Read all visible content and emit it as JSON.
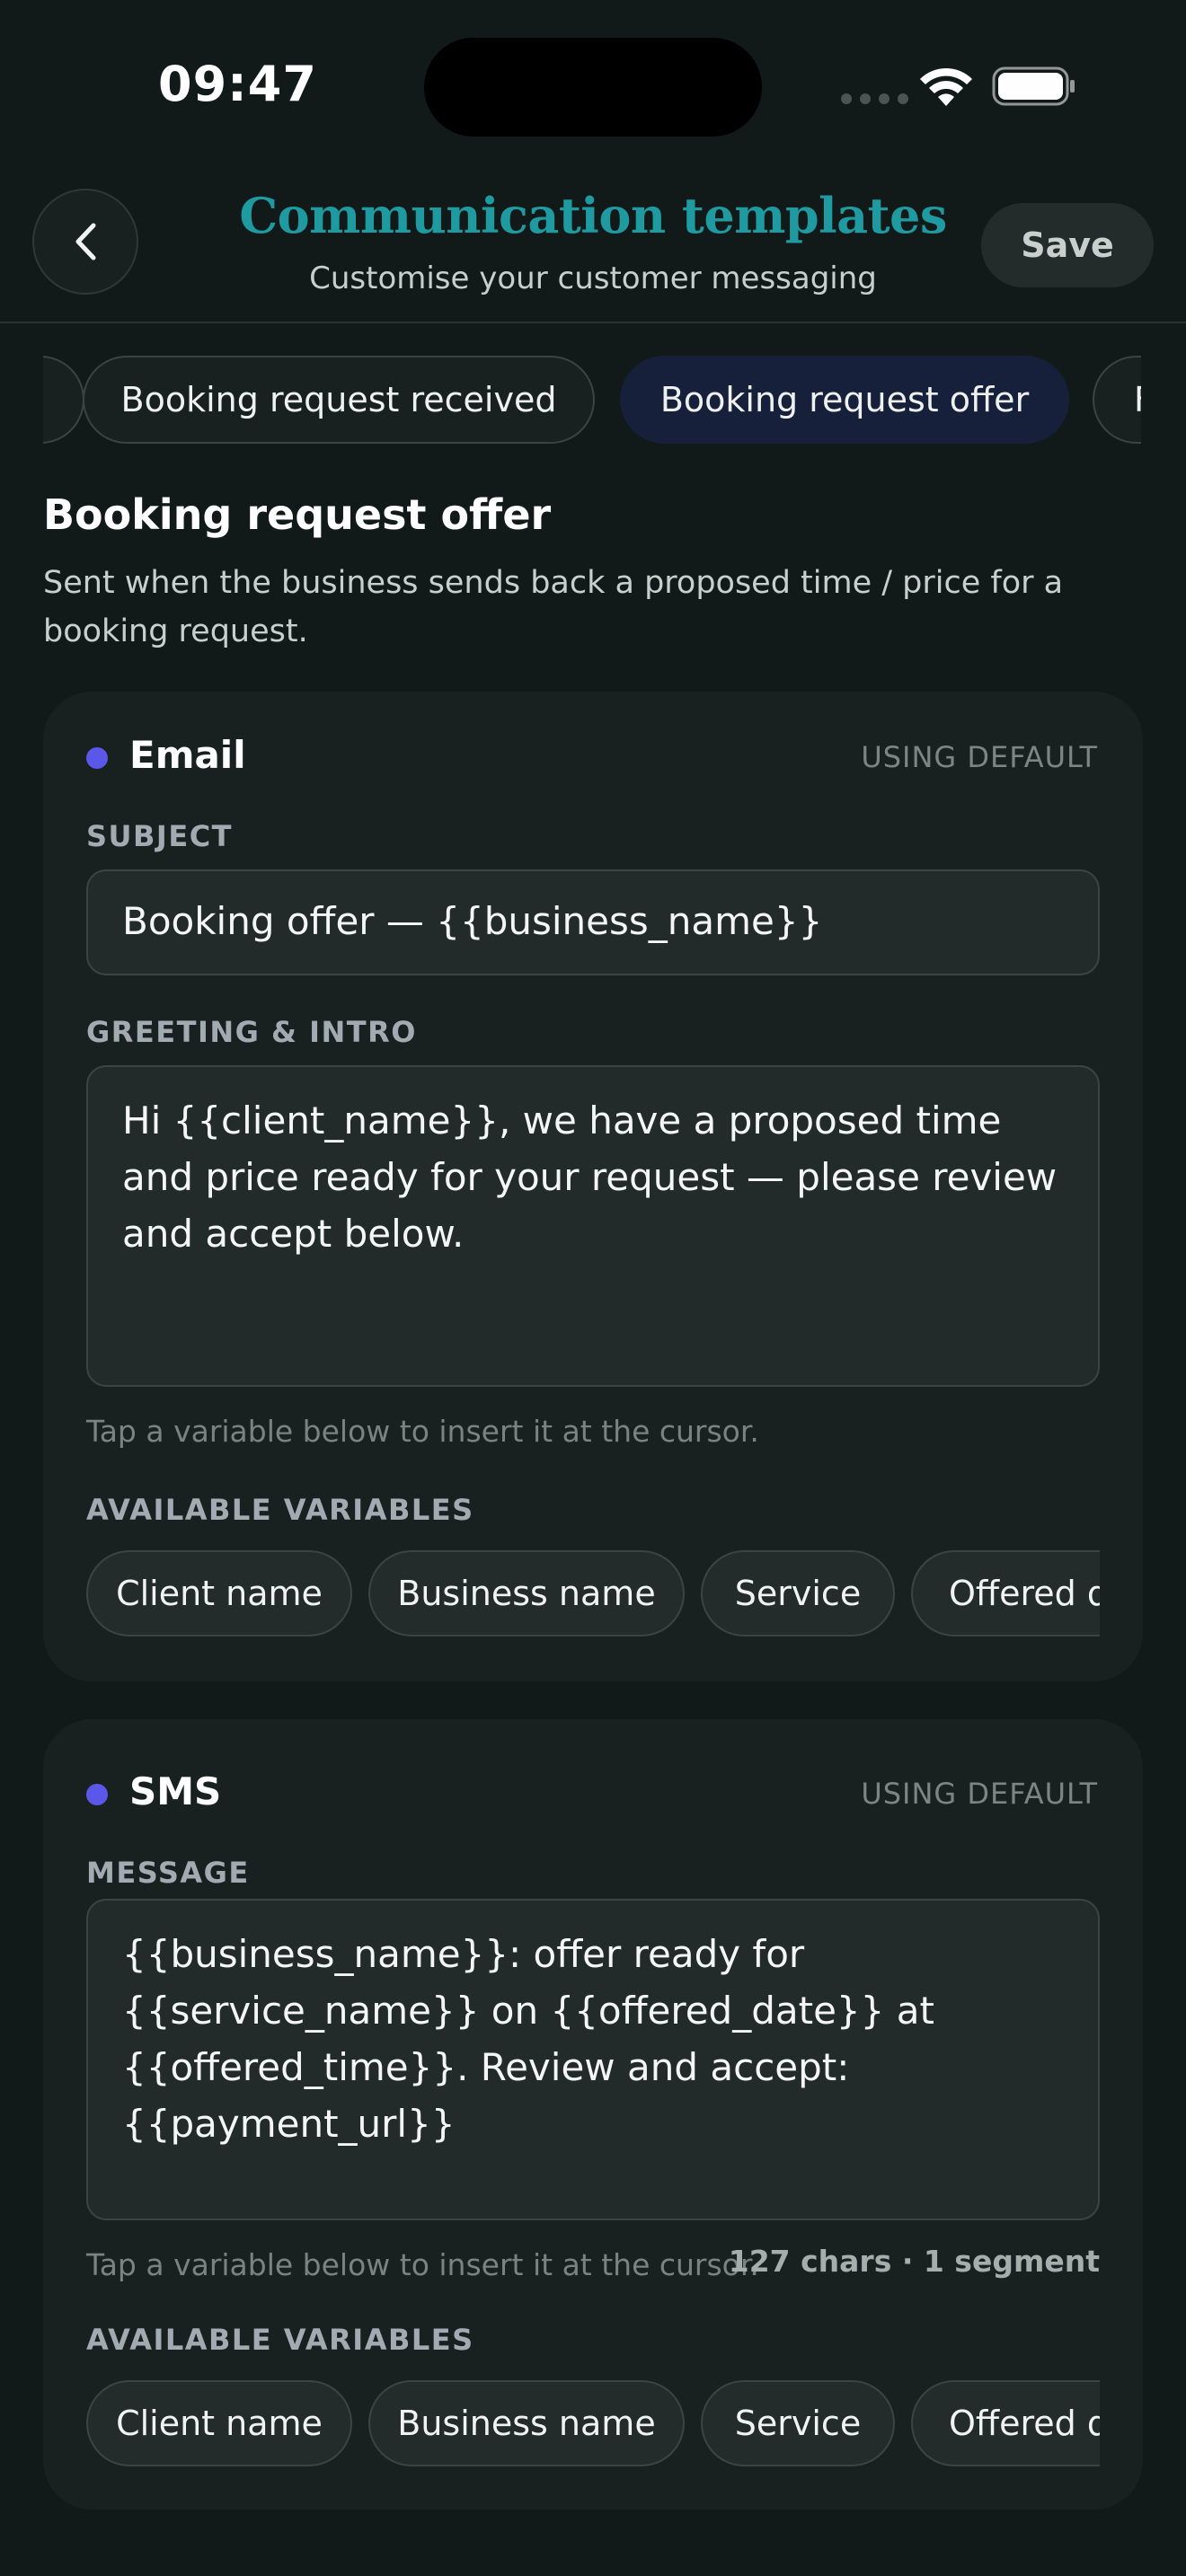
{
  "status_bar": {
    "time": "09:47"
  },
  "header": {
    "title": "Communication templates",
    "subtitle": "Customise your customer messaging",
    "save_label": "Save"
  },
  "tabs": [
    {
      "label": ""
    },
    {
      "label": "Booking request received"
    },
    {
      "label": "Booking request offer",
      "active": true
    },
    {
      "label": "F"
    }
  ],
  "section": {
    "title": "Booking request offer",
    "description": "Sent when the business sends back a proposed time / price for a booking request."
  },
  "email": {
    "channel": "Email",
    "status": "USING DEFAULT",
    "subject_label": "SUBJECT",
    "subject_value": "Booking offer — {{business_name}}",
    "greeting_label": "GREETING & INTRO",
    "greeting_value": "Hi {{client_name}}, we have a proposed time and price ready for your request — please review and accept below.",
    "hint": "Tap a variable below to insert it at the cursor.",
    "variables_label": "AVAILABLE VARIABLES",
    "variables": [
      "Client name",
      "Business name",
      "Service",
      "Offered d"
    ]
  },
  "sms": {
    "channel": "SMS",
    "status": "USING DEFAULT",
    "message_label": "MESSAGE",
    "message_value": "{{business_name}}: offer ready for {{service_name}} on {{offered_date}} at {{offered_time}}. Review and accept: {{payment_url}}",
    "hint": "Tap a variable below to insert it at the cursor.",
    "char_count": "127 chars · 1 segment",
    "variables_label": "AVAILABLE VARIABLES",
    "variables": [
      "Client name",
      "Business name",
      "Service",
      "Offered d"
    ]
  },
  "colors": {
    "background": "#111a18",
    "title_teal": "#1e9aa0",
    "channel_dot": "#5b57e8",
    "active_tab": "#16203a"
  }
}
